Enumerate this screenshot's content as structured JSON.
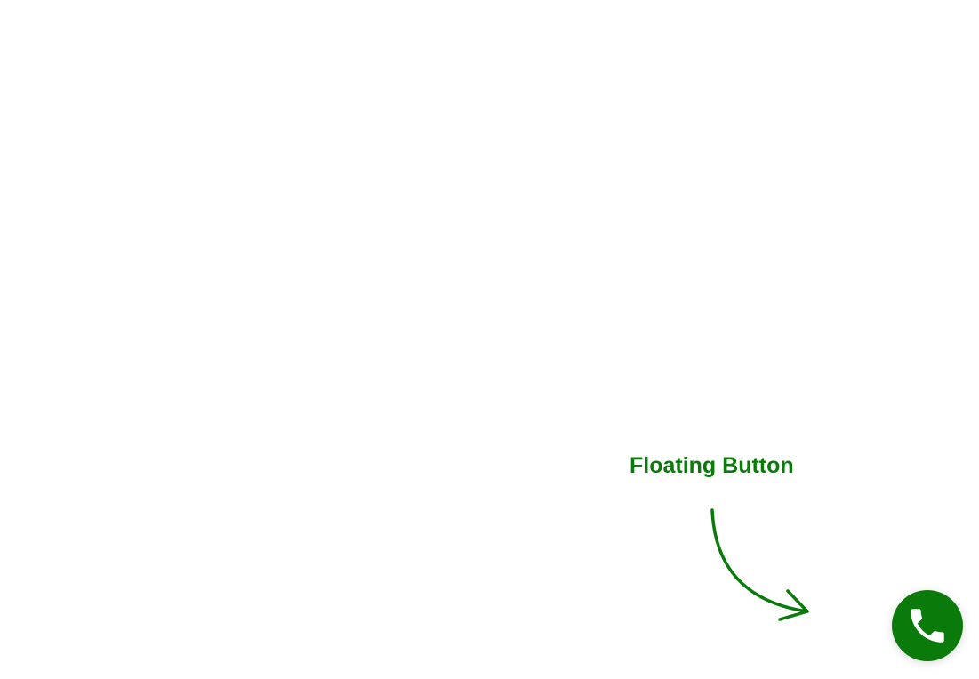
{
  "annotation": {
    "label": "Floating Button",
    "arrow_icon": "curved-arrow",
    "color": "#0a7a0a"
  },
  "fab": {
    "icon": "phone-icon",
    "background_color": "#0a7a0a",
    "icon_color": "#ffffff"
  },
  "page": {
    "background_color": "#ffffff"
  }
}
